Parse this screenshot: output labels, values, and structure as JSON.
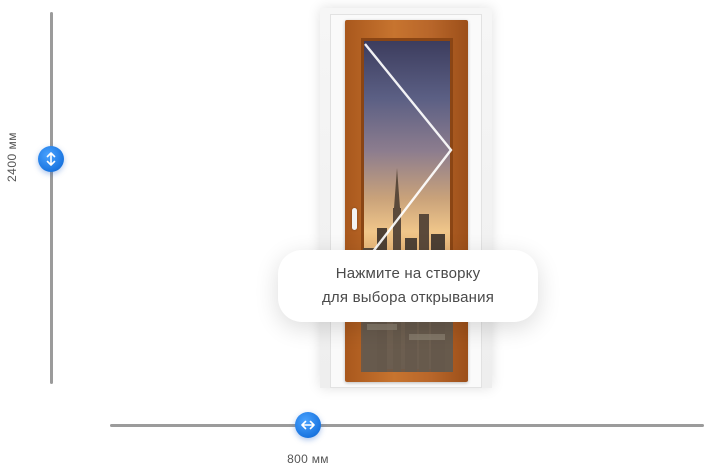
{
  "height_control": {
    "label": "2400 мм",
    "icon": "vertical-arrows-icon",
    "accent": "#1a75e0"
  },
  "width_control": {
    "label": "800 мм",
    "icon": "horizontal-arrows-icon",
    "accent": "#1a75e0"
  },
  "tooltip": {
    "line1": "Нажмите на створку",
    "line2": "для выбора открывания"
  },
  "window": {
    "frame_color": "#b8662a"
  }
}
